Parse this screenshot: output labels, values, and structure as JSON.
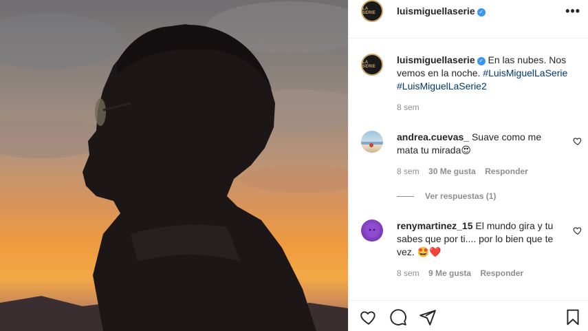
{
  "post": {
    "username": "luismiguellaserie",
    "avatar_text": "LA SERIE",
    "more_icon": "•••",
    "caption_text": "En las nubes. Nos vemos en la noche.",
    "hashtag_1": "#LuisMiguelLaSerie",
    "hashtag_2": "#LuisMiguelLaSerie2",
    "time": "8 sem"
  },
  "comments": [
    {
      "username": "andrea.cuevas_",
      "text_line1": "Suave como me",
      "text_line2": "mata tu mirada",
      "emoji": "😍",
      "time": "8 sem",
      "likes": "30 Me gusta",
      "reply": "Responder",
      "view_replies": "Ver respuestas (1)"
    },
    {
      "username": "renymartinez_15",
      "text_line1": "El mundo gira y",
      "text_line2": "tu sabes que por ti.... por lo bien",
      "text_line3": "que te vez.",
      "emoji": "🤩❤️",
      "time": "8 sem",
      "likes": "9 Me gusta",
      "reply": "Responder"
    }
  ],
  "colors": {
    "verified": "#3897f0",
    "hashtag": "#00376b",
    "muted": "#8e8e8e",
    "text": "#262626"
  }
}
